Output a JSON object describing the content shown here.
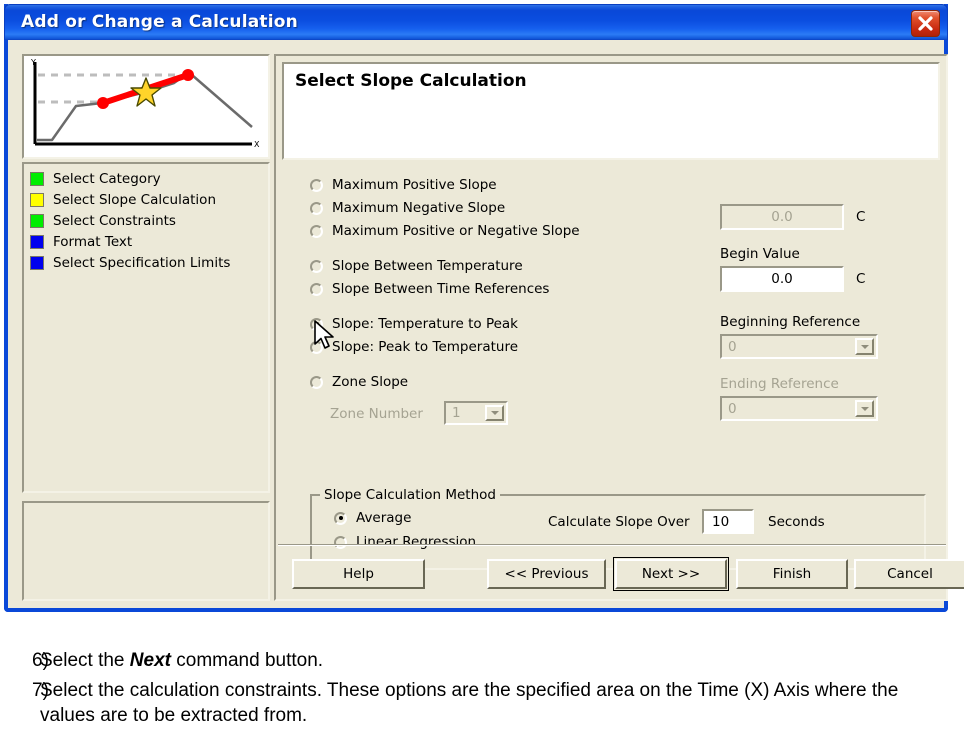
{
  "window": {
    "title": "Add or Change a Calculation",
    "close_icon": "close-icon",
    "close_label": "Close"
  },
  "sidebar": {
    "thumbnail": {
      "name": "profile-preview-thumbnail",
      "x_axis_label": "X",
      "y_axis_label": "Y"
    },
    "steps": [
      {
        "label": "Select Category",
        "color": "#00ee00"
      },
      {
        "label": "Select Slope Calculation",
        "color": "#ffff00"
      },
      {
        "label": "Select Constraints",
        "color": "#00ee00"
      },
      {
        "label": "Format Text",
        "color": "#0000ee"
      },
      {
        "label": "Select Specification Limits",
        "color": "#0000ee"
      }
    ]
  },
  "main": {
    "header_title": "Select Slope Calculation",
    "slope_options": [
      {
        "label": "Maximum Positive Slope",
        "selected": false
      },
      {
        "label": "Maximum Negative Slope",
        "selected": false
      },
      {
        "label": "Maximum Positive or Negative Slope",
        "selected": false
      },
      {
        "label": "Slope Between Temperature",
        "selected": false
      },
      {
        "label": "Slope Between Time References",
        "selected": false
      },
      {
        "label": "Slope: Temperature to Peak",
        "selected": true
      },
      {
        "label": "Slope: Peak to Temperature",
        "selected": false
      },
      {
        "label": "Zone Slope",
        "selected": false
      }
    ],
    "zone_number": {
      "label": "Zone Number",
      "value": "1",
      "enabled": false
    },
    "end_value": {
      "value": "0.0",
      "unit": "C",
      "enabled": false
    },
    "begin_value": {
      "label": "Begin Value",
      "value": "0.0",
      "unit": "C",
      "enabled": true
    },
    "beginning_reference": {
      "label": "Beginning Reference",
      "value": "0",
      "enabled": false
    },
    "ending_reference": {
      "label": "Ending Reference",
      "value": "0",
      "enabled": false
    },
    "method_group": {
      "title": "Slope Calculation Method",
      "options": [
        {
          "label": "Average",
          "selected": true
        },
        {
          "label": "Linear Regression",
          "selected": false
        }
      ],
      "calc_over_label": "Calculate Slope Over",
      "calc_over_value": "10",
      "calc_over_unit": "Seconds"
    }
  },
  "footer": {
    "help": "Help",
    "previous": "<< Previous",
    "next": "Next >>",
    "finish": "Finish",
    "cancel": "Cancel"
  },
  "instructions": [
    {
      "num": "6)",
      "pre": "Select the ",
      "bold": "Next",
      "post": " command button."
    },
    {
      "num": "7)",
      "pre": "Select the calculation constraints. These options are the specified area on the Time (X) Axis where the values are to be extracted from.",
      "bold": "",
      "post": ""
    }
  ],
  "colors": {
    "titlebar_blue": "#0a48d8",
    "dialog_face": "#ece9d8",
    "close_red": "#c92a10",
    "slope_line_red": "#ff0000",
    "star_yellow": "#ffd42a"
  }
}
